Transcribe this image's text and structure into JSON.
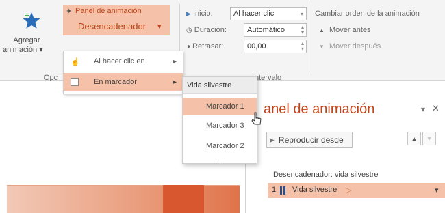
{
  "ribbon": {
    "agregar": {
      "line1": "Agregar",
      "line2": "animación"
    },
    "agregar_dropdown_glyph": "▾",
    "panel_animacion": "Panel de animación",
    "desencadenador": "Desencadenador",
    "desencadenador_glyph": "▾",
    "group_label": "Opc",
    "inicio_label": "Inicio:",
    "inicio_value": "Al hacer clic",
    "duracion_label": "Duración:",
    "duracion_value": "Automático",
    "retrasar_label": "Retrasar:",
    "retrasar_value": "00,00",
    "intervalo_label": "ntervalo",
    "cambiar_orden": "Cambiar orden de la animación",
    "mover_antes": "Mover antes",
    "mover_despues": "Mover después"
  },
  "trigger_menu": {
    "items": [
      {
        "label": "Al hacer clic en",
        "arrow": "▸"
      },
      {
        "label": "En marcador",
        "arrow": "▸"
      }
    ]
  },
  "bookmark_menu": {
    "header": "Vida silvestre",
    "items": [
      "Marcador 1",
      "Marcador 3",
      "Marcador 2"
    ],
    "more": "....."
  },
  "pane": {
    "title": "anel de animación",
    "pin_glyph": "▾",
    "close_glyph": "✕",
    "play_button": "Reproducir desde",
    "up_glyph": "▲",
    "down_glyph": "▼",
    "trigger_label": "Desencadenador: vida silvestre",
    "item_index": "1",
    "item_label": "Vida silvestre",
    "item_dropdown": "▾"
  },
  "colors": {
    "accent": "#c0451b",
    "highlight": "#f5c1a8",
    "star": "#2b6cb8"
  }
}
